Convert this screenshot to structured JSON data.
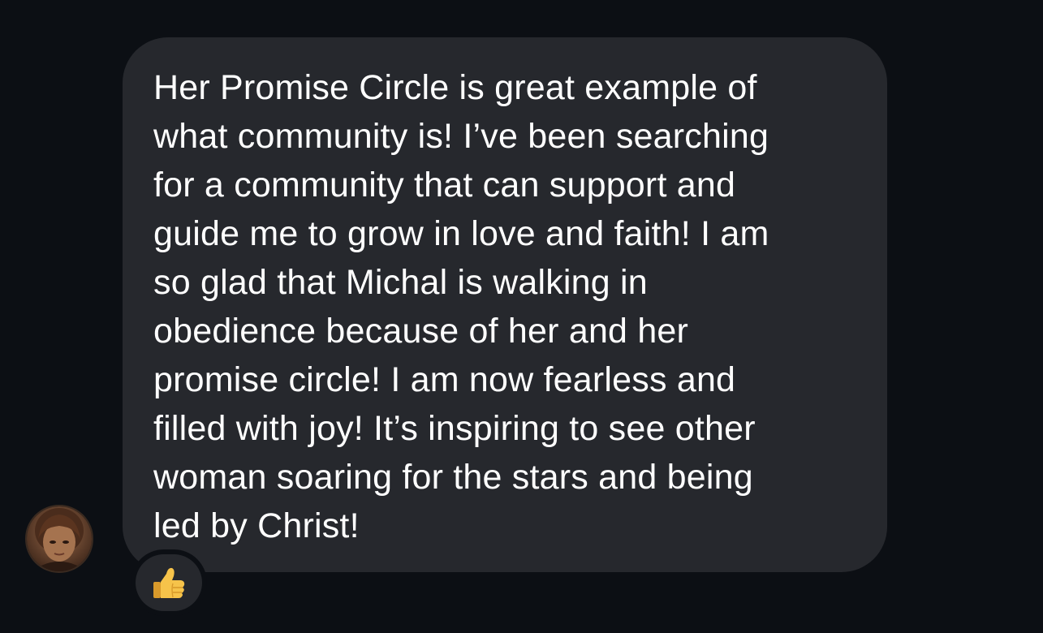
{
  "message": {
    "text": "Her Promise Circle is great example of\nwhat community is! I’ve been searching\nfor a community that can support and\nguide me to grow in love and faith! I am\nso glad that Michal is walking in\nobedience because of her and her\npromise circle! I am now fearless and\nfilled with joy! It’s inspiring to see other\nwoman soaring for the stars and being\nled by Christ!"
  },
  "reaction": {
    "icon": "thumbs-up-icon"
  },
  "avatar": {
    "icon": "user-avatar"
  },
  "colors": {
    "background": "#0c0f14",
    "bubble": "#26282d",
    "text": "#ffffff",
    "thumb": "#f6c34a"
  }
}
